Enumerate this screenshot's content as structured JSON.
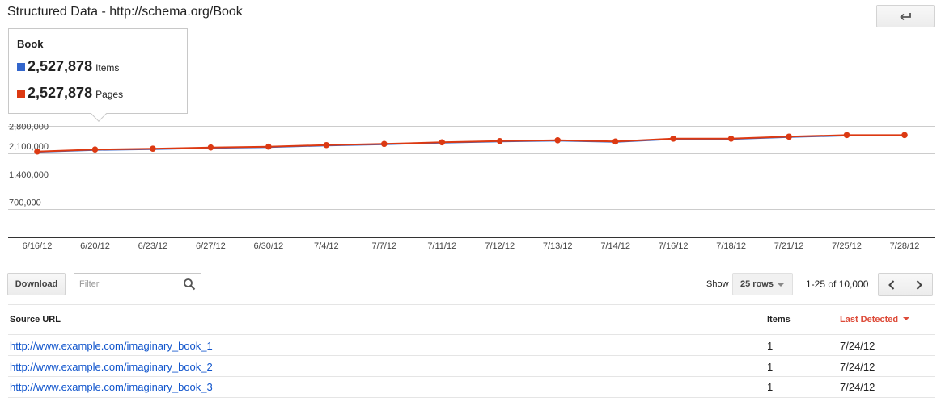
{
  "page": {
    "title": "Structured Data - http://schema.org/Book"
  },
  "tooltip": {
    "title": "Book",
    "rows": [
      {
        "value": "2,527,878",
        "label": "Items",
        "color": "#3366cc"
      },
      {
        "value": "2,527,878",
        "label": "Pages",
        "color": "#dc3912"
      }
    ]
  },
  "chart_data": {
    "type": "line",
    "categories": [
      "6/16/12",
      "6/20/12",
      "6/23/12",
      "6/27/12",
      "6/30/12",
      "7/4/12",
      "7/7/12",
      "7/11/12",
      "7/12/12",
      "7/13/12",
      "7/14/12",
      "7/16/12",
      "7/18/12",
      "7/21/12",
      "7/25/12",
      "7/28/12"
    ],
    "x_tick_labels": [
      "6/16/12",
      "6/20/12",
      "6/23/12",
      "6/27/12",
      "6/30/12",
      "7/4/12",
      "7/7/12",
      "7/11/12",
      "7/12/12",
      "7/13/12",
      "7/14/12",
      "7/16/12",
      "7/18/12",
      "7/21/12",
      "7/25/12",
      "7/28/12"
    ],
    "y_tick_labels": [
      "2,800,000",
      "2,100,000",
      "1,400,000",
      "700,000"
    ],
    "y_ticks": [
      2800000,
      2100000,
      1400000,
      700000
    ],
    "ylim": [
      0,
      2800000
    ],
    "grid": true,
    "series": [
      {
        "name": "Items",
        "color": "#3366cc",
        "values": [
          2140000,
          2190000,
          2210000,
          2240000,
          2260000,
          2300000,
          2330000,
          2370000,
          2400000,
          2420000,
          2390000,
          2460000,
          2460000,
          2510000,
          2550000,
          2550000
        ]
      },
      {
        "name": "Pages",
        "color": "#dc3912",
        "values": [
          2150000,
          2200000,
          2220000,
          2250000,
          2270000,
          2310000,
          2340000,
          2380000,
          2410000,
          2430000,
          2400000,
          2470000,
          2470000,
          2520000,
          2560000,
          2560000
        ]
      }
    ]
  },
  "toolbar": {
    "download_label": "Download",
    "filter_placeholder": "Filter",
    "show_label": "Show",
    "rows_selected": "25 rows",
    "range_label": "1-25 of 10,000"
  },
  "table": {
    "columns": [
      "Source URL",
      "Items",
      "Last Detected"
    ],
    "sorted_color": "#dd4b39",
    "link_color": "#1155cc",
    "rows": [
      {
        "url": "http://www.example.com/imaginary_book_1",
        "items": "1",
        "last_detected": "7/24/12"
      },
      {
        "url": "http://www.example.com/imaginary_book_2",
        "items": "1",
        "last_detected": "7/24/12"
      },
      {
        "url": "http://www.example.com/imaginary_book_3",
        "items": "1",
        "last_detected": "7/24/12"
      }
    ]
  }
}
